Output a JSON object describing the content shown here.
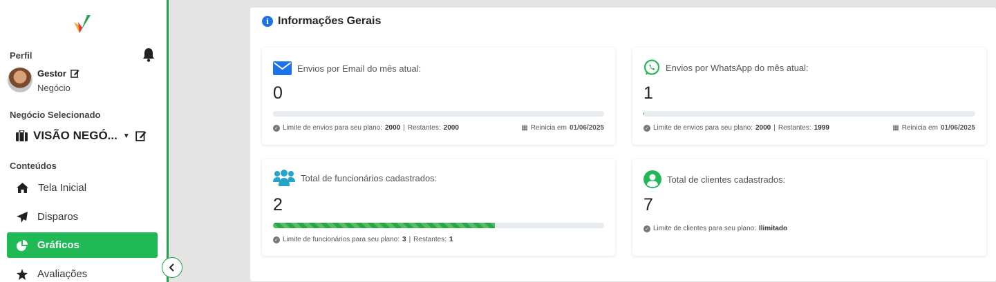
{
  "sidebar": {
    "profile_title": "Perfil",
    "user_name": "Gestor",
    "user_role": "Negócio",
    "business_title": "Negócio Selecionado",
    "business_name": "VISÃO NEGÓ...",
    "contents_title": "Conteúdos",
    "items": [
      {
        "label": "Tela Inicial",
        "icon": "home-icon"
      },
      {
        "label": "Disparos",
        "icon": "send-icon"
      },
      {
        "label": "Gráficos",
        "icon": "pie-chart-icon",
        "active": true
      },
      {
        "label": "Avaliações",
        "icon": "star-icon"
      }
    ],
    "accent_color": "#1fb955"
  },
  "main": {
    "title": "Informações Gerais",
    "cards": [
      {
        "title": "Envios por Email do mês atual:",
        "value": "0",
        "progress": 0,
        "limit_label": "Limite de envios para seu plano:",
        "limit_value": "2000",
        "remaining_label": "Restantes:",
        "remaining_value": "2000",
        "reset_label": "Reinicia em",
        "reset_date": "01/06/2025"
      },
      {
        "title": "Envios por WhatsApp do mês atual:",
        "value": "1",
        "progress": 0.0005,
        "limit_label": "Limite de envios para seu plano:",
        "limit_value": "2000",
        "remaining_label": "Restantes:",
        "remaining_value": "1999",
        "reset_label": "Reinicia em",
        "reset_date": "01/06/2025"
      },
      {
        "title": "Total de funcionários cadastrados:",
        "value": "2",
        "progress": 0.67,
        "limit_label": "Limite de funcionários para seu plano:",
        "limit_value": "3",
        "remaining_label": "Restantes:",
        "remaining_value": "1"
      },
      {
        "title": "Total de clientes cadastrados:",
        "value": "7",
        "limit_label": "Limite de clientes para seu plano:",
        "limit_value": "Ilimitado"
      }
    ]
  }
}
